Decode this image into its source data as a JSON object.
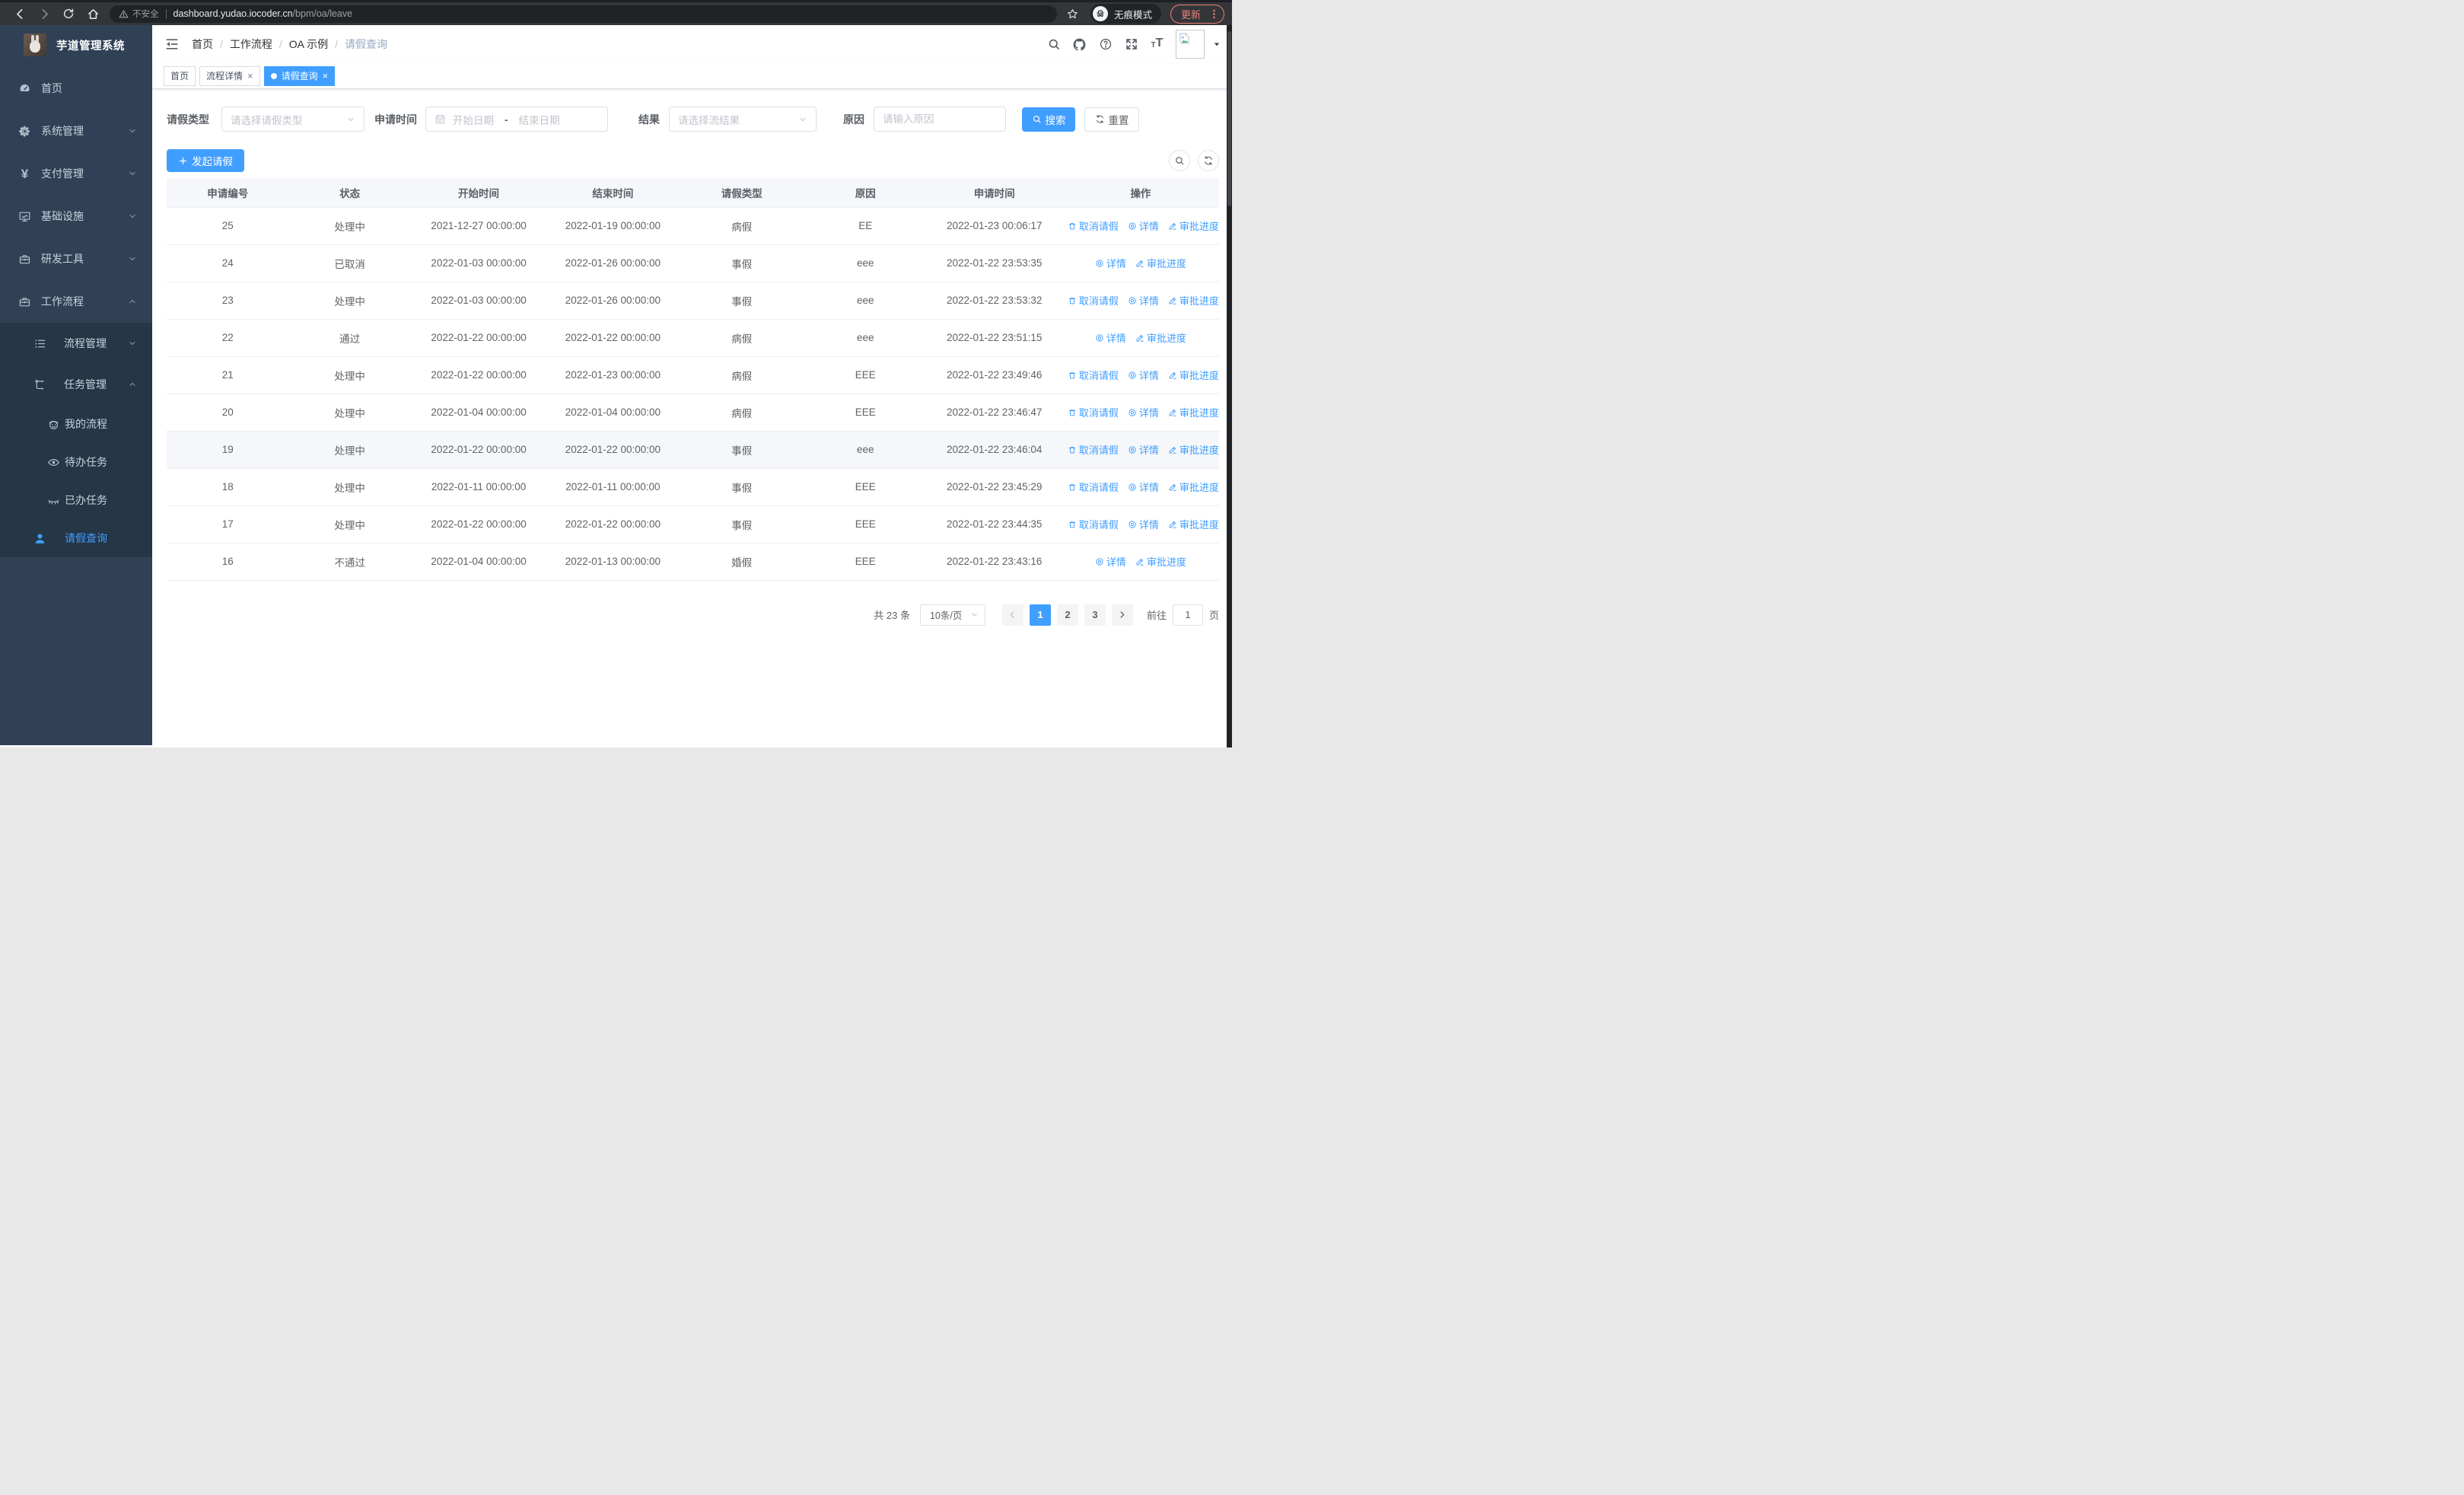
{
  "colors": {
    "primary": "#409eff",
    "sidebar_bg": "#304156",
    "submenu_bg": "#253647",
    "chrome_accent": "#ee8277"
  },
  "browser": {
    "security_label": "不安全",
    "url_host": "dashboard.yudao.iocoder.cn",
    "url_path": "/bpm/oa/leave",
    "incognito_label": "无痕模式",
    "update_label": "更新"
  },
  "sidebar": {
    "app_title": "芋道管理系统",
    "menu": [
      {
        "name": "home",
        "label": "首页",
        "icon": "dashboard-icon",
        "depth": 1
      },
      {
        "name": "system-management",
        "label": "系统管理",
        "icon": "gear-icon",
        "depth": 1,
        "arrow": "down"
      },
      {
        "name": "payment-management",
        "label": "支付管理",
        "icon": "yen-icon",
        "depth": 1,
        "arrow": "down"
      },
      {
        "name": "infrastructure",
        "label": "基础设施",
        "icon": "monitor-icon",
        "depth": 1,
        "arrow": "down"
      },
      {
        "name": "dev-tools",
        "label": "研发工具",
        "icon": "toolbox-icon",
        "depth": 1,
        "arrow": "down"
      },
      {
        "name": "workflow",
        "label": "工作流程",
        "icon": "briefcase-icon",
        "depth": 1,
        "arrow": "up"
      },
      {
        "name": "process-management",
        "label": "流程管理",
        "icon": "list-icon",
        "depth": 2,
        "arrow": "down"
      },
      {
        "name": "task-management",
        "label": "任务管理",
        "icon": "flow-icon",
        "depth": 2,
        "arrow": "up"
      },
      {
        "name": "my-process",
        "label": "我的流程",
        "icon": "robot-icon",
        "depth": 3
      },
      {
        "name": "todo-tasks",
        "label": "待办任务",
        "icon": "eye-icon",
        "depth": 3
      },
      {
        "name": "done-tasks",
        "label": "已办任务",
        "icon": "eye-closed-icon",
        "depth": 3
      },
      {
        "name": "leave-query",
        "label": "请假查询",
        "icon": "user-icon",
        "depth": 3,
        "active": true,
        "narrow": true
      }
    ]
  },
  "header": {
    "breadcrumb": [
      "首页",
      "工作流程",
      "OA 示例",
      "请假查询"
    ]
  },
  "tabs": [
    {
      "name": "home",
      "label": "首页",
      "active": false,
      "closable": false
    },
    {
      "name": "process-detail",
      "label": "流程详情",
      "active": false,
      "closable": true
    },
    {
      "name": "leave-query",
      "label": "请假查询",
      "active": true,
      "closable": true
    }
  ],
  "filters": {
    "leave_type_label": "请假类型",
    "leave_type_placeholder": "请选择请假类型",
    "apply_time_label": "申请时间",
    "start_date_placeholder": "开始日期",
    "range_separator": "-",
    "end_date_placeholder": "结束日期",
    "result_label": "结果",
    "result_placeholder": "请选择流结果",
    "reason_label": "原因",
    "reason_placeholder": "请输入原因",
    "search_label": "搜索",
    "reset_label": "重置"
  },
  "toolbar": {
    "create_label": "发起请假"
  },
  "table": {
    "columns": [
      "申请编号",
      "状态",
      "开始时间",
      "结束时间",
      "请假类型",
      "原因",
      "申请时间",
      "操作"
    ],
    "action_defs": {
      "cancel": {
        "label": "取消请假",
        "icon": "delete-icon"
      },
      "detail": {
        "label": "详情",
        "icon": "view-icon"
      },
      "progress": {
        "label": "审批进度",
        "icon": "edit-icon"
      }
    },
    "rows": [
      {
        "id": "25",
        "status": "处理中",
        "start": "2021-12-27 00:00:00",
        "end": "2022-01-19 00:00:00",
        "type": "病假",
        "reason": "EE",
        "apply_time": "2022-01-23 00:06:17",
        "actions": [
          "cancel",
          "detail",
          "progress"
        ]
      },
      {
        "id": "24",
        "status": "已取消",
        "start": "2022-01-03 00:00:00",
        "end": "2022-01-26 00:00:00",
        "type": "事假",
        "reason": "eee",
        "apply_time": "2022-01-22 23:53:35",
        "actions": [
          "detail",
          "progress"
        ]
      },
      {
        "id": "23",
        "status": "处理中",
        "start": "2022-01-03 00:00:00",
        "end": "2022-01-26 00:00:00",
        "type": "事假",
        "reason": "eee",
        "apply_time": "2022-01-22 23:53:32",
        "actions": [
          "cancel",
          "detail",
          "progress"
        ]
      },
      {
        "id": "22",
        "status": "通过",
        "start": "2022-01-22 00:00:00",
        "end": "2022-01-22 00:00:00",
        "type": "病假",
        "reason": "eee",
        "apply_time": "2022-01-22 23:51:15",
        "actions": [
          "detail",
          "progress"
        ]
      },
      {
        "id": "21",
        "status": "处理中",
        "start": "2022-01-22 00:00:00",
        "end": "2022-01-23 00:00:00",
        "type": "病假",
        "reason": "EEE",
        "apply_time": "2022-01-22 23:49:46",
        "actions": [
          "cancel",
          "detail",
          "progress"
        ]
      },
      {
        "id": "20",
        "status": "处理中",
        "start": "2022-01-04 00:00:00",
        "end": "2022-01-04 00:00:00",
        "type": "病假",
        "reason": "EEE",
        "apply_time": "2022-01-22 23:46:47",
        "actions": [
          "cancel",
          "detail",
          "progress"
        ]
      },
      {
        "id": "19",
        "status": "处理中",
        "start": "2022-01-22 00:00:00",
        "end": "2022-01-22 00:00:00",
        "type": "事假",
        "reason": "eee",
        "apply_time": "2022-01-22 23:46:04",
        "actions": [
          "cancel",
          "detail",
          "progress"
        ],
        "highlight": true
      },
      {
        "id": "18",
        "status": "处理中",
        "start": "2022-01-11 00:00:00",
        "end": "2022-01-11 00:00:00",
        "type": "事假",
        "reason": "EEE",
        "apply_time": "2022-01-22 23:45:29",
        "actions": [
          "cancel",
          "detail",
          "progress"
        ]
      },
      {
        "id": "17",
        "status": "处理中",
        "start": "2022-01-22 00:00:00",
        "end": "2022-01-22 00:00:00",
        "type": "事假",
        "reason": "EEE",
        "apply_time": "2022-01-22 23:44:35",
        "actions": [
          "cancel",
          "detail",
          "progress"
        ]
      },
      {
        "id": "16",
        "status": "不通过",
        "start": "2022-01-04 00:00:00",
        "end": "2022-01-13 00:00:00",
        "type": "婚假",
        "reason": "EEE",
        "apply_time": "2022-01-22 23:43:16",
        "actions": [
          "detail",
          "progress"
        ]
      }
    ]
  },
  "pagination": {
    "total_label": "共 23 条",
    "page_size_label": "10条/页",
    "pages": [
      "1",
      "2",
      "3"
    ],
    "active_page": "1",
    "goto_label": "前往",
    "goto_value": "1",
    "unit_label": "页"
  }
}
